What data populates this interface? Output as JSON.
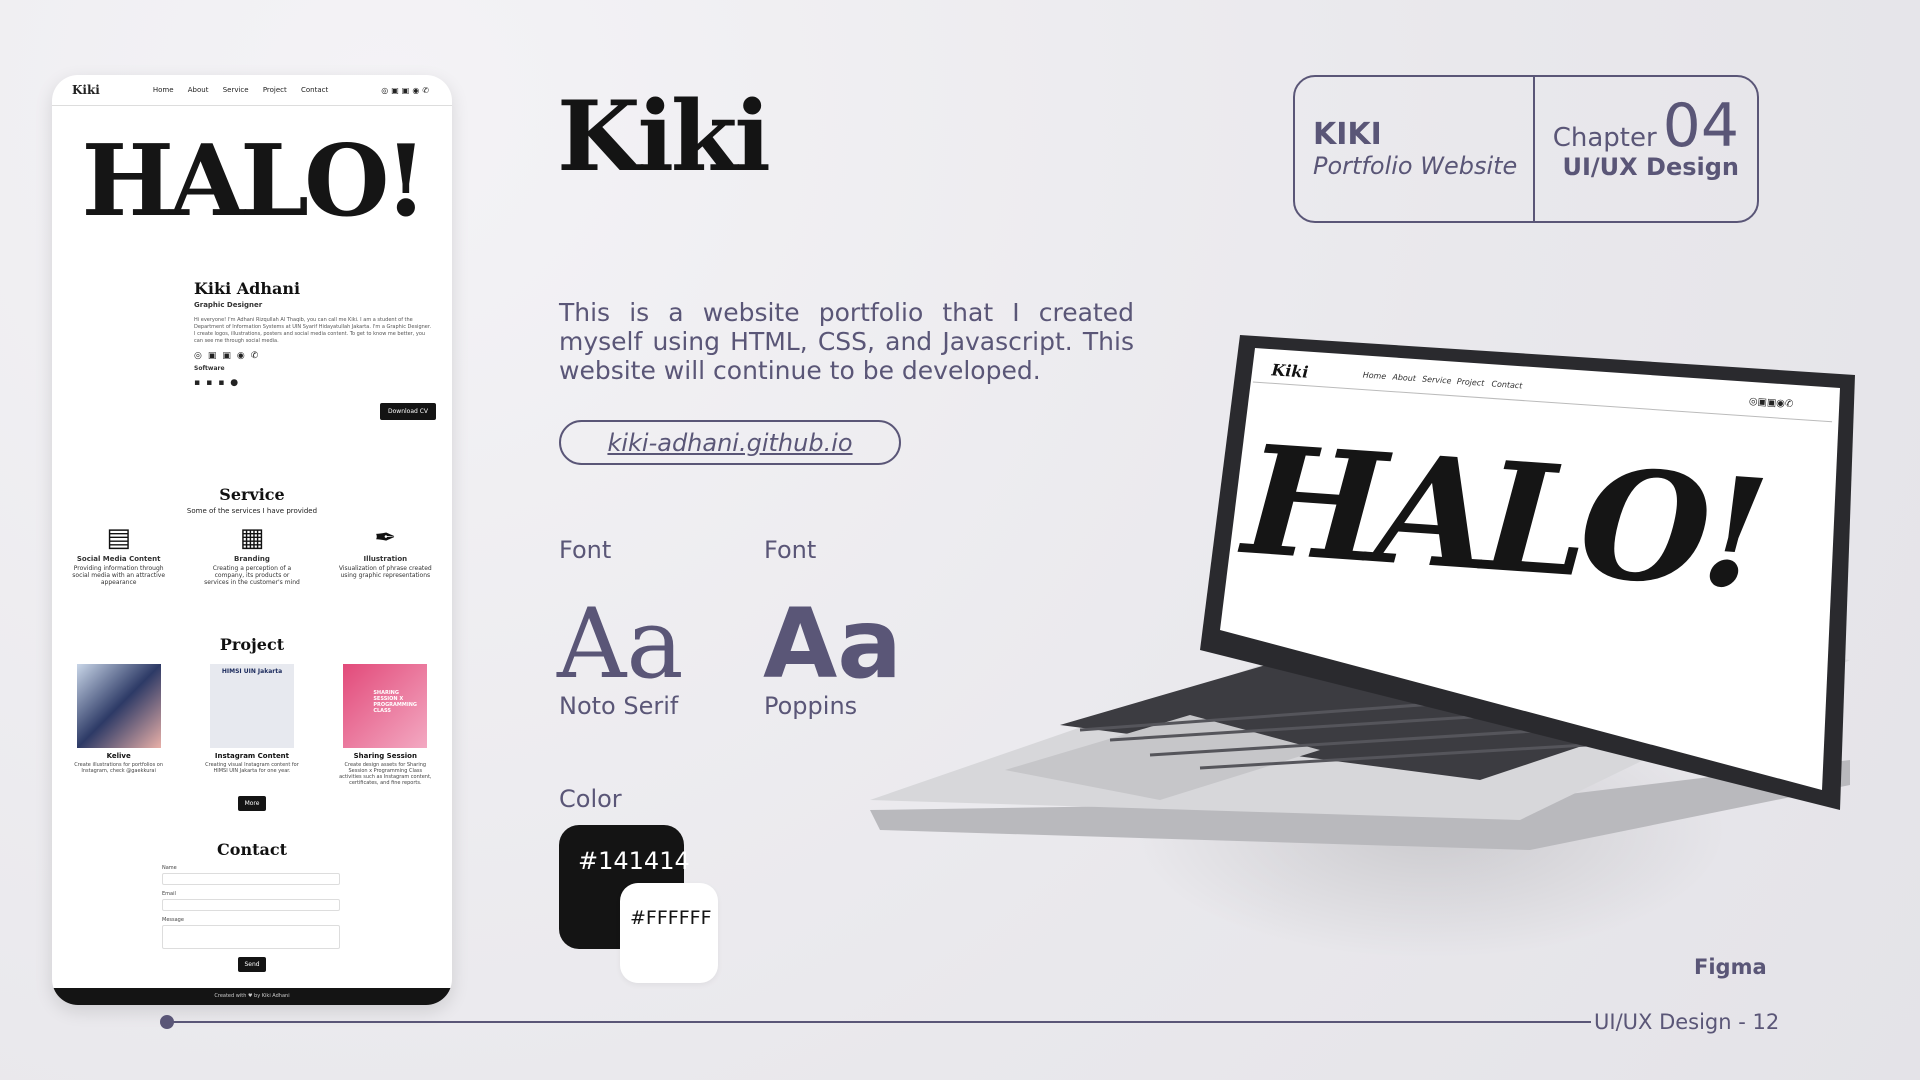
{
  "phone": {
    "nav_logo": "Kiki",
    "nav_links": [
      "Home",
      "About",
      "Service",
      "Project",
      "Contact"
    ],
    "hero": "HALO!",
    "profile_name": "Kiki Adhani",
    "profile_role": "Graphic Designer",
    "profile_bio": "Hi everyone! I'm Adhani Rizqullah Al Thaqib, you can call me Kiki. I am a student of the Department of Information Systems at UIN Syarif Hidayatullah Jakarta. I'm a Graphic Designer. I create logos, illustrations, posters and social media content. To get to know me better, you can see me through social media.",
    "software_label": "Software",
    "download_label": "Download CV",
    "service_title": "Service",
    "service_sub": "Some of the services I have provided",
    "services": [
      {
        "title": "Social Media Content",
        "text": "Providing information through social media with an attractive appearance"
      },
      {
        "title": "Branding",
        "text": "Creating a perception of a company, its products or services in the customer's mind"
      },
      {
        "title": "Illustration",
        "text": "Visualization of phrase created using graphic representations"
      }
    ],
    "project_title": "Project",
    "projects": [
      {
        "title": "Kelive",
        "text": "Create illustrations for portfolios on Instagram, check @gaekkurai"
      },
      {
        "title": "Instagram Content",
        "text": "Creating visual Instagram content for HIMSI UIN Jakarta for one year."
      },
      {
        "title": "Sharing Session",
        "text": "Create design assets for Sharing Session x Programming Class activities such as Instagram content, certificates, and fine reports."
      }
    ],
    "project_banner": "HIMSI UIN Jakarta",
    "project_poster": "SHARING SESSION X PROGRAMMING CLASS",
    "more_label": "More",
    "contact_title": "Contact",
    "contact_fields": [
      "Name",
      "Email",
      "Message"
    ],
    "send_label": "Send",
    "footer": "Created with ♥ by Kiki Adhani"
  },
  "main": {
    "title": "Kiki",
    "description": "This is a website portfolio that I created myself using HTML, CSS, and Javascript. This website will continue to be developed.",
    "url": "kiki-adhani.github.io",
    "font_label_1": "Font",
    "font_label_2": "Font",
    "font_sample": "Aa",
    "font_name_1": "Noto Serif",
    "font_name_2": "Poppins",
    "color_label": "Color",
    "color_1": "#141414",
    "color_2": "#FFFFFF"
  },
  "card": {
    "name": "KIKI",
    "subtitle": "Portfolio Website",
    "chapter_label": "Chapter",
    "chapter_number": "04",
    "category": "UI/UX Design"
  },
  "footer": {
    "tool": "Figma",
    "page_label": "UI/UX Design - 12"
  },
  "laptop": {
    "nav_logo": "Kiki",
    "nav_links": [
      "Home",
      "About",
      "Service",
      "Project",
      "Contact"
    ],
    "hero": "HALO!"
  },
  "colors": {
    "accent": "#5a5677",
    "dark": "#141414",
    "light": "#ffffff",
    "background": "#ecebef"
  }
}
